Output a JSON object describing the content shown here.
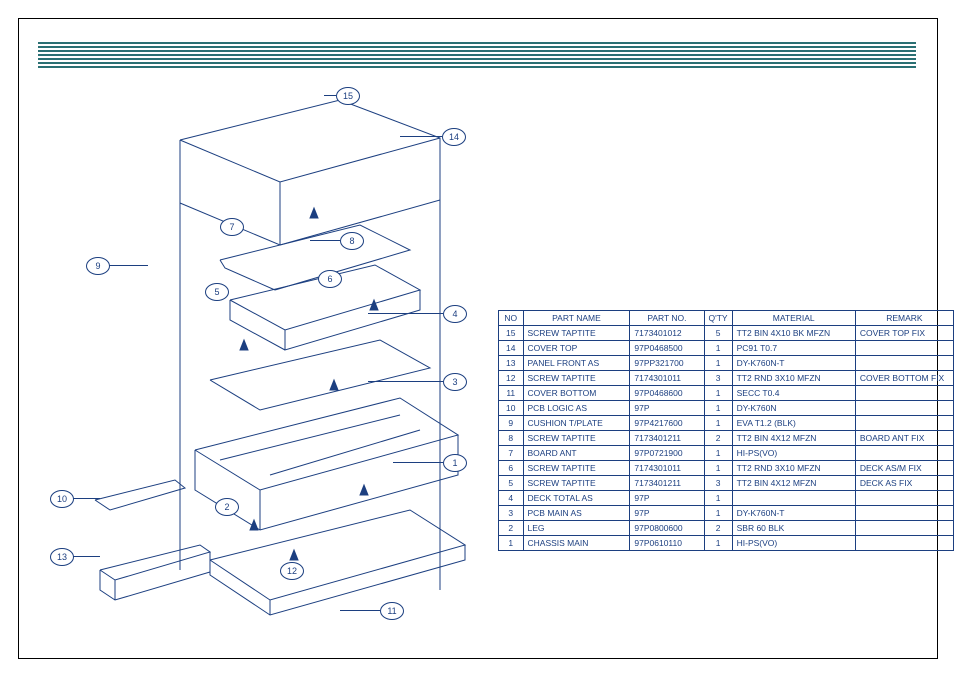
{
  "table": {
    "headers": [
      "NO",
      "PART NAME",
      "PART NO.",
      "Q'TY",
      "MATERIAL",
      "REMARK"
    ],
    "rows": [
      {
        "no": "15",
        "name": "SCREW TAPTITE",
        "part": "7173401012",
        "qty": "5",
        "mat": "TT2 BIN 4X10 BK MFZN",
        "rem": "COVER TOP FIX"
      },
      {
        "no": "14",
        "name": "COVER TOP",
        "part": "97P0468500",
        "qty": "1",
        "mat": "PC91 T0.7",
        "rem": ""
      },
      {
        "no": "13",
        "name": "PANEL FRONT AS",
        "part": "97PP321700",
        "qty": "1",
        "mat": "DY-K760N-T",
        "rem": ""
      },
      {
        "no": "12",
        "name": "SCREW TAPTITE",
        "part": "7174301011",
        "qty": "3",
        "mat": "TT2 RND 3X10 MFZN",
        "rem": "COVER BOTTOM FIX"
      },
      {
        "no": "11",
        "name": "COVER BOTTOM",
        "part": "97P0468600",
        "qty": "1",
        "mat": "SECC T0.4",
        "rem": ""
      },
      {
        "no": "10",
        "name": "PCB LOGIC AS",
        "part": "97P",
        "qty": "1",
        "mat": "DY-K760N",
        "rem": ""
      },
      {
        "no": "9",
        "name": "CUSHION T/PLATE",
        "part": "97P4217600",
        "qty": "1",
        "mat": "EVA T1.2 (BLK)",
        "rem": ""
      },
      {
        "no": "8",
        "name": "SCREW TAPTITE",
        "part": "7173401211",
        "qty": "2",
        "mat": "TT2 BIN 4X12 MFZN",
        "rem": "BOARD ANT FIX"
      },
      {
        "no": "7",
        "name": "BOARD ANT",
        "part": "97P0721900",
        "qty": "1",
        "mat": "HI-PS(VO)",
        "rem": ""
      },
      {
        "no": "6",
        "name": "SCREW TAPTITE",
        "part": "7174301011",
        "qty": "1",
        "mat": "TT2 RND 3X10 MFZN",
        "rem": "DECK AS/M FIX"
      },
      {
        "no": "5",
        "name": "SCREW TAPTITE",
        "part": "7173401211",
        "qty": "3",
        "mat": "TT2 BIN 4X12 MFZN",
        "rem": "DECK AS FIX"
      },
      {
        "no": "4",
        "name": "DECK TOTAL AS",
        "part": "97P",
        "qty": "1",
        "mat": "",
        "rem": ""
      },
      {
        "no": "3",
        "name": "PCB MAIN AS",
        "part": "97P",
        "qty": "1",
        "mat": "DY-K760N-T",
        "rem": ""
      },
      {
        "no": "2",
        "name": "LEG",
        "part": "97P0800600",
        "qty": "2",
        "mat": "SBR 60 BLK",
        "rem": ""
      },
      {
        "no": "1",
        "name": "CHASSIS MAIN",
        "part": "97P0610110",
        "qty": "1",
        "mat": "HI-PS(VO)",
        "rem": ""
      }
    ]
  },
  "callouts": [
    "1",
    "2",
    "3",
    "4",
    "5",
    "6",
    "7",
    "8",
    "9",
    "10",
    "11",
    "12",
    "13",
    "14",
    "15"
  ]
}
